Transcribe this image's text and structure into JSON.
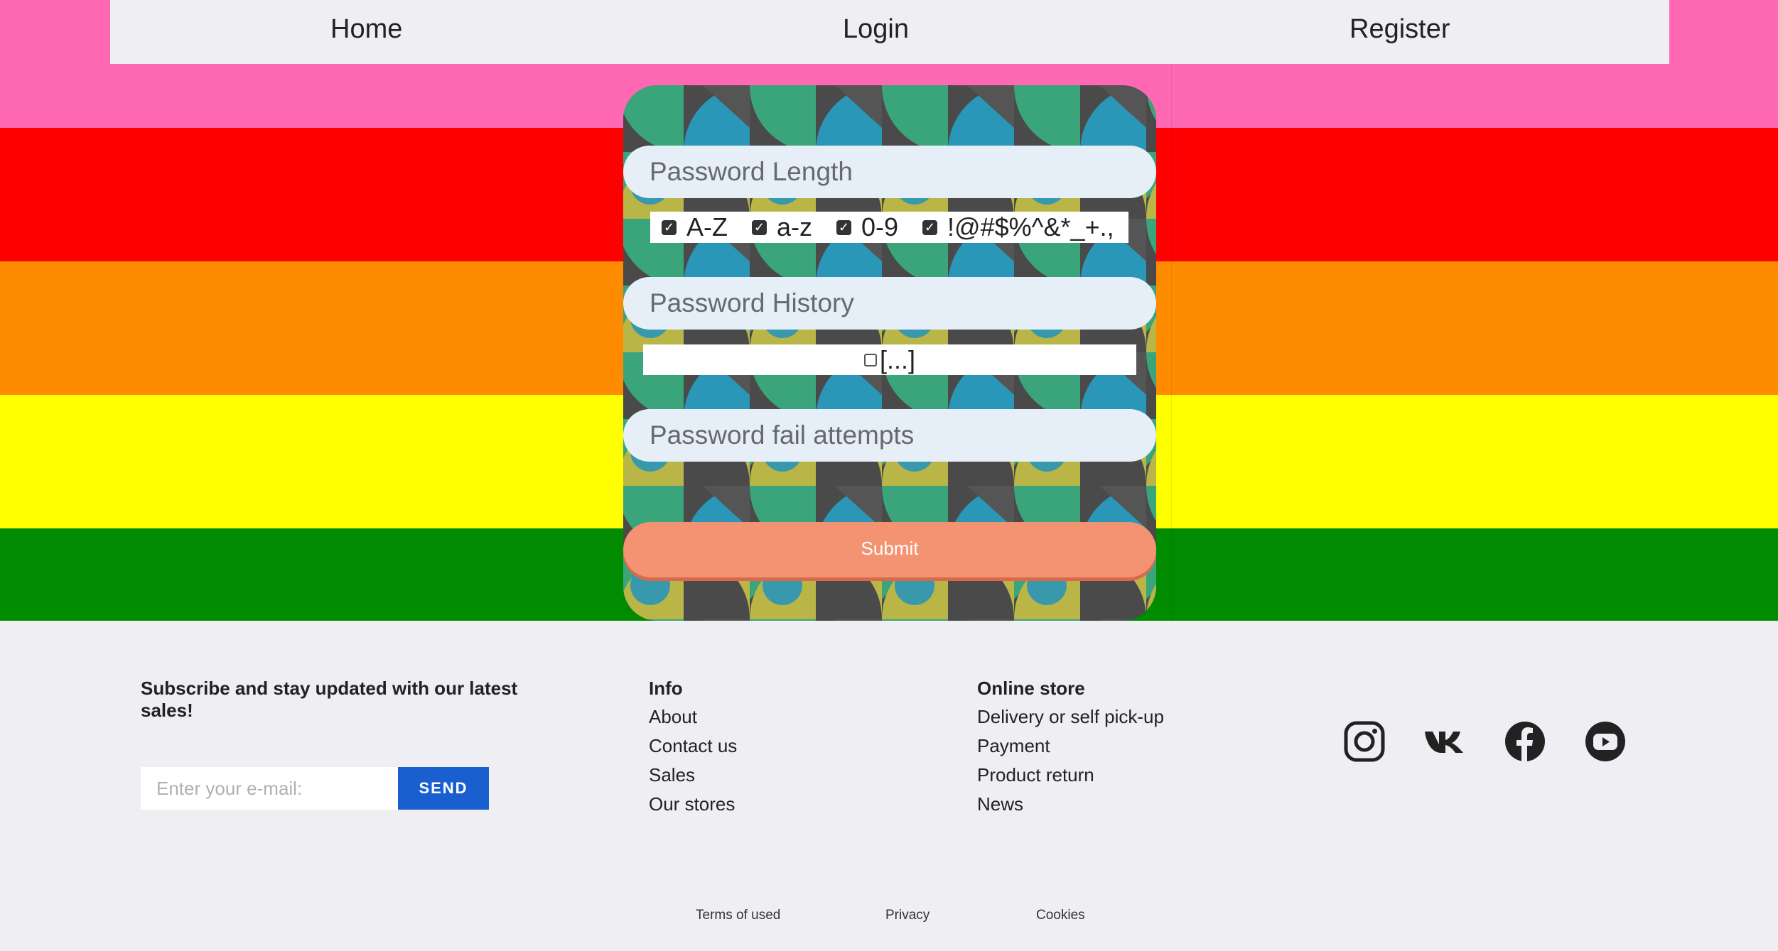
{
  "nav": {
    "home": "Home",
    "login": "Login",
    "register": "Register"
  },
  "form": {
    "length_placeholder": "Password Length",
    "charsets": [
      "A-Z",
      "a-z",
      "0-9",
      "!@#$%^&*_+.,"
    ],
    "history_placeholder": "Password History",
    "history_toggle_label": "[...]",
    "fail_placeholder": "Password fail attempts",
    "submit_label": "Submit"
  },
  "footer": {
    "subscribe_title": "Subscribe and stay updated with our latest sales!",
    "email_placeholder": "Enter your e-mail:",
    "send_label": "SEND",
    "info": {
      "title": "Info",
      "links": [
        "About",
        "Contact us",
        "Sales",
        "Our stores"
      ]
    },
    "store": {
      "title": "Online store",
      "links": [
        "Delivery or self pick-up",
        "Payment",
        "Product return",
        "News"
      ]
    },
    "social_icons": [
      "instagram-icon",
      "vk-icon",
      "facebook-icon",
      "youtube-icon"
    ],
    "legal": [
      "Terms of used",
      "Privacy",
      "Cookies"
    ]
  },
  "colors": {
    "stripes": [
      "#ff69b4",
      "#ff0000",
      "#ff8c00",
      "#ffff00",
      "#008b00"
    ],
    "submit": "#f49372",
    "send": "#1a5fcf"
  }
}
